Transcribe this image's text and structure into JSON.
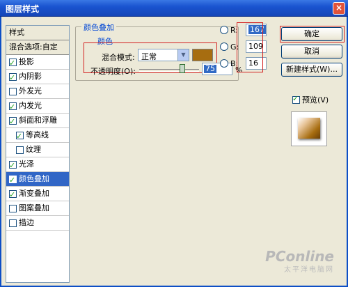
{
  "window": {
    "title": "图层样式",
    "close": "×"
  },
  "styles_panel": {
    "header": "样式",
    "blend_options": "混合选项:自定",
    "items": [
      {
        "label": "投影",
        "checked": true
      },
      {
        "label": "内阴影",
        "checked": true
      },
      {
        "label": "外发光",
        "checked": false
      },
      {
        "label": "内发光",
        "checked": true
      },
      {
        "label": "斜面和浮雕",
        "checked": true
      },
      {
        "label": "等高线",
        "checked": true
      },
      {
        "label": "纹理",
        "checked": false
      },
      {
        "label": "光泽",
        "checked": true
      },
      {
        "label": "颜色叠加",
        "checked": true,
        "selected": true
      },
      {
        "label": "渐变叠加",
        "checked": true
      },
      {
        "label": "图案叠加",
        "checked": false
      },
      {
        "label": "描边",
        "checked": false
      }
    ]
  },
  "color_overlay": {
    "group_title": "颜色叠加",
    "sub_title": "颜色",
    "blend_mode_label": "混合模式:",
    "blend_mode_value": "正常",
    "color": "#a76d10",
    "opacity_label": "不透明度(O):",
    "opacity_value": "75",
    "opacity_unit": "%",
    "opacity_fraction": 0.75
  },
  "color_picker": {
    "r_label": "R:",
    "r_value": "167",
    "g_label": "G:",
    "g_value": "109",
    "b_label": "B:",
    "b_value": "16"
  },
  "buttons": {
    "ok": "确定",
    "cancel": "取消",
    "new_style": "新建样式(W)...",
    "preview": "预览(V)"
  },
  "watermark": {
    "brand": "PConline",
    "sub": "太平洋电脑网"
  }
}
